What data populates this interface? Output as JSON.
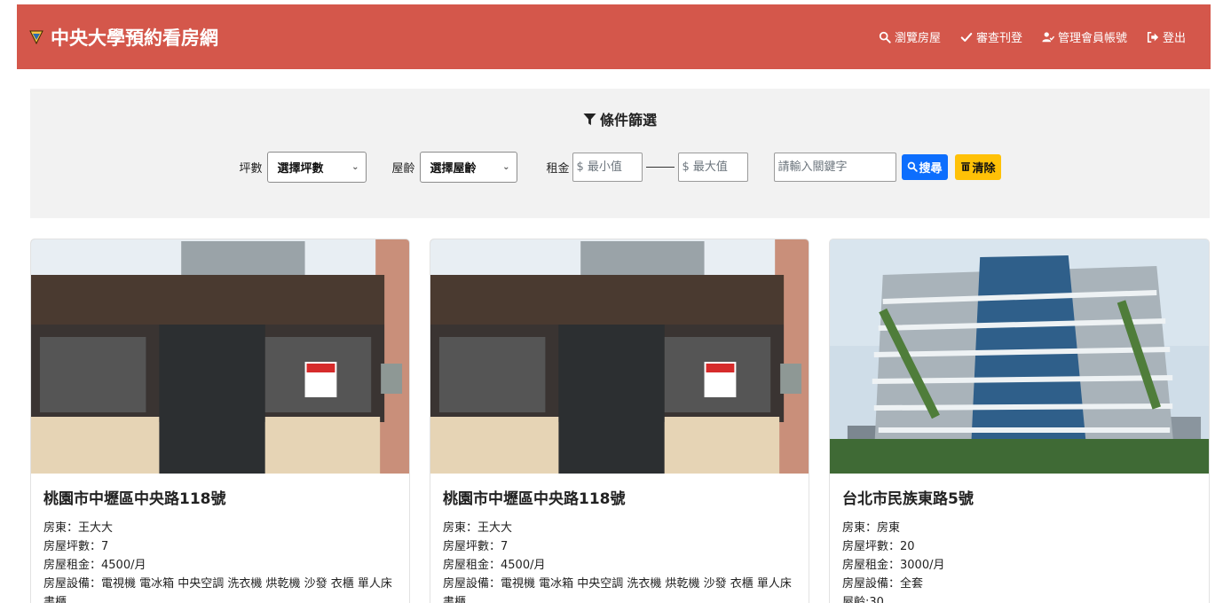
{
  "navbar": {
    "brand": "中央大學預約看房網",
    "links": [
      {
        "label": "瀏覽房屋",
        "icon": "search-icon"
      },
      {
        "label": "審查刊登",
        "icon": "check-icon"
      },
      {
        "label": "管理會員帳號",
        "icon": "user-check-icon"
      },
      {
        "label": "登出",
        "icon": "logout-icon"
      }
    ]
  },
  "filter": {
    "title": "條件篩選",
    "size_label": "坪數",
    "size_select": "選擇坪數",
    "age_label": "屋齡",
    "age_select": "選擇屋齡",
    "rent_label": "租金",
    "rent_min_placeholder": "$ 最小值",
    "rent_max_placeholder": "$ 最大值",
    "keyword_placeholder": "請輸入關鍵字",
    "search_label": "搜尋",
    "clear_label": "清除"
  },
  "cards": [
    {
      "title": "桃園市中壢區中央路118號",
      "landlord": "房東：王大大",
      "size": "房屋坪數：7",
      "rent": "房屋租金：4500/月",
      "equipment": "房屋設備：電視機 電冰箱 中央空調 洗衣機 烘乾機 沙發 衣櫃 單人床 書櫃"
    },
    {
      "title": "桃園市中壢區中央路118號",
      "landlord": "房東：王大大",
      "size": "房屋坪數：7",
      "rent": "房屋租金：4500/月",
      "equipment": "房屋設備：電視機 電冰箱 中央空調 洗衣機 烘乾機 沙發 衣櫃 單人床 書櫃"
    },
    {
      "title": "台北市民族東路5號",
      "landlord": "房東：房東",
      "size": "房屋坪數：20",
      "rent": "房屋租金：3000/月",
      "equipment": "房屋設備：全套",
      "age": "屋齡:30"
    }
  ],
  "colors": {
    "navbar": "#d4574b",
    "filter_bg": "#f2f2f2",
    "search_button": "#0d6efd",
    "clear_button": "#ffc107"
  }
}
